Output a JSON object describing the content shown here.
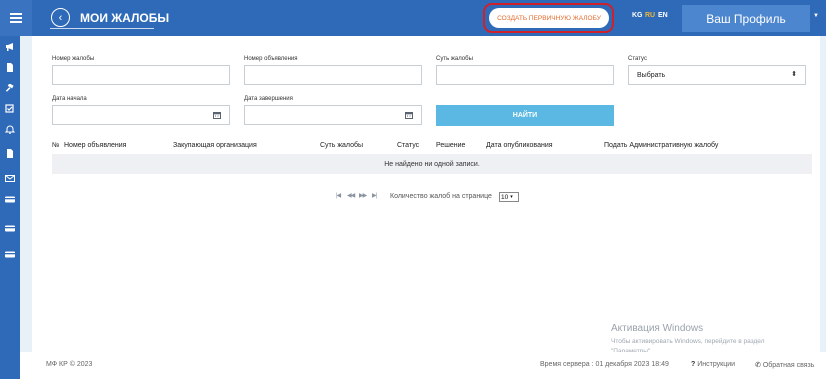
{
  "header": {
    "title": "МОИ ЖАЛОБЫ",
    "create_button": "СОЗДАТЬ ПЕРВИЧНУЮ ЖАЛОБУ",
    "languages": [
      {
        "code": "KG",
        "active": false
      },
      {
        "code": "RU",
        "active": true
      },
      {
        "code": "EN",
        "active": false
      }
    ],
    "profile_button": "Ваш Профиль"
  },
  "sidebar": {
    "icons": [
      "megaphone-icon",
      "document-icon",
      "gavel-icon",
      "checklist-icon",
      "bell-icon",
      "document-icon",
      "envelope-icon",
      "card-icon",
      "card-icon",
      "card-icon"
    ]
  },
  "filters": {
    "complaint_number": {
      "label": "Номер жалобы",
      "value": ""
    },
    "announcement_number": {
      "label": "Номер объявления",
      "value": ""
    },
    "complaint_essence": {
      "label": "Суть жалобы",
      "value": ""
    },
    "status": {
      "label": "Статус",
      "value": "Выбрать"
    },
    "start_date": {
      "label": "Дата начала",
      "value": ""
    },
    "end_date": {
      "label": "Дата завершения",
      "value": ""
    },
    "search_button": "НАЙТИ"
  },
  "table": {
    "columns": [
      "№",
      "Номер объявления",
      "Закупающая организация",
      "Суть жалобы",
      "Статус",
      "Решение",
      "Дата опубликования",
      "Подать Административную жалобу"
    ],
    "empty_message": "Не найдено ни одной записи."
  },
  "pagination": {
    "per_page_label": "Количество жалоб на странице",
    "per_page_value": "10"
  },
  "footer": {
    "copyright": "МФ КР © 2023",
    "server_time": "Время сервера : 01 декабря 2023 18:49",
    "instructions": "Инструкции",
    "feedback": "Обратная связь"
  },
  "watermark": {
    "title": "Активация Windows",
    "subtitle": "Чтобы активировать Windows, перейдите в раздел \"Параметры\"."
  },
  "colors": {
    "header_blue": "#2f6ab8",
    "accent_orange": "#e66a2c",
    "highlight_red": "#d0202a",
    "search_button": "#5ab8e2",
    "lang_active": "#f0b830"
  }
}
